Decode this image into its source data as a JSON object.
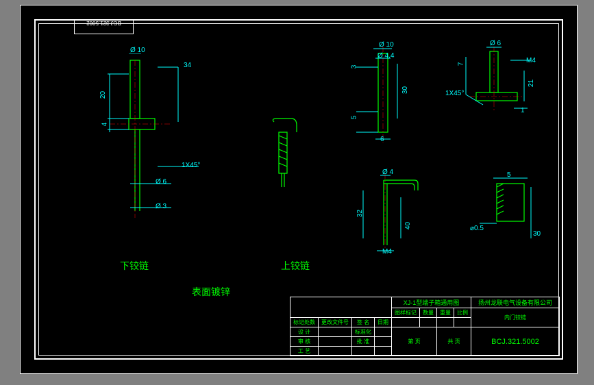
{
  "tab_label": "BCJ.321.5002",
  "labels": {
    "lower_hinge": "下铰链",
    "upper_hinge": "上铰链",
    "surface_finish": "表面镀锌"
  },
  "dims": {
    "d10a": "Ø 10",
    "n34": "34",
    "n20": "20",
    "n4a": "4",
    "chamfer1": "1X45°",
    "d6": "Ø 6",
    "d3": "Ø 3",
    "d10b": "Ø 10",
    "d4_4": "Ø 4.4",
    "n3": "3",
    "n30": "30",
    "n5": "5",
    "n6": "6",
    "d4": "Ø 4",
    "n32": "32",
    "n40": "40",
    "m4": "M4",
    "d6b": "Ø 6",
    "m4b": "M4",
    "n7": "7",
    "n21": "21",
    "chamfer2": "1X45°",
    "n1": "1",
    "n5b": "5",
    "slot": "⌀0.5",
    "n30b": "30"
  },
  "titleblock": {
    "project": "XJ-1型端子箱通用图",
    "company": "扬州龙联电气设备有限公司",
    "part_name": "内门铰链",
    "drawing_no": "BCJ.321.5002",
    "r1c1": "标记处数",
    "r1c2": "更改文件号",
    "r1c3": "签 名",
    "r1c4": "日期",
    "r2a": "设 计",
    "r2b": "标准化",
    "r3a": "审 核",
    "r3b": "批 准",
    "r4a": "工 艺",
    "h1": "图样标记",
    "h2": "数量",
    "h3": "重量",
    "h4": "比例",
    "b1": "第  页",
    "b2": "共  页"
  }
}
